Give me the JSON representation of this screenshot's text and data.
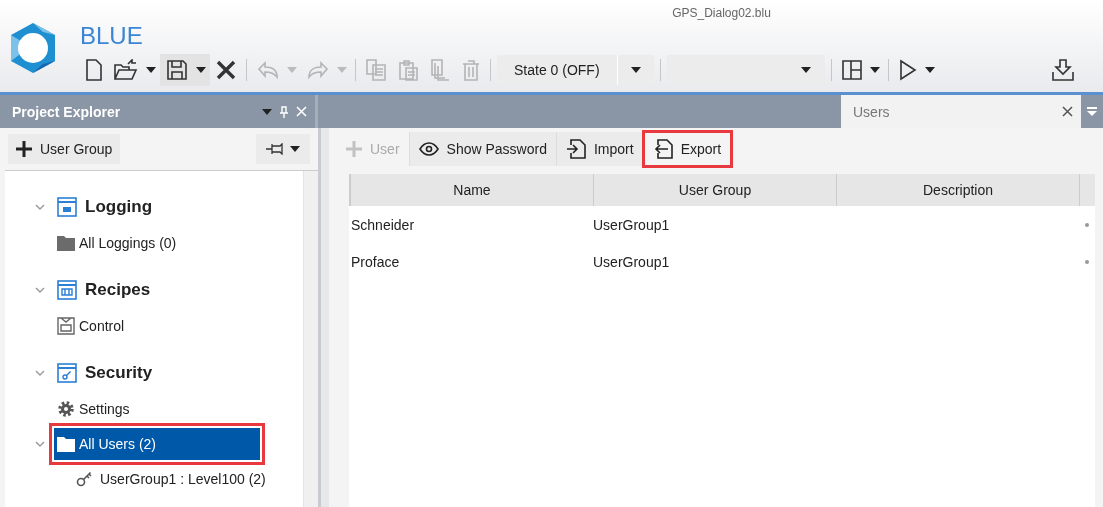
{
  "window": {
    "title": "GPS_Dialog02.blu"
  },
  "app": {
    "name": "BLUE"
  },
  "toolbar": [
    {
      "kind": "new",
      "disabled": false,
      "dropdown": false,
      "pressed": false
    },
    {
      "kind": "open",
      "disabled": false,
      "dropdown": true,
      "pressed": false
    },
    {
      "kind": "save",
      "disabled": false,
      "dropdown": true,
      "pressed": true
    },
    {
      "kind": "close",
      "disabled": false,
      "dropdown": false,
      "pressed": false
    },
    {
      "kind": "separator"
    },
    {
      "kind": "undo",
      "disabled": true,
      "dropdown": true,
      "pressed": false
    },
    {
      "kind": "redo",
      "disabled": true,
      "dropdown": true,
      "pressed": false
    },
    {
      "kind": "separator"
    },
    {
      "kind": "copy",
      "disabled": true,
      "dropdown": false,
      "pressed": false
    },
    {
      "kind": "paste",
      "disabled": true,
      "dropdown": false,
      "pressed": false
    },
    {
      "kind": "duplicate",
      "disabled": true,
      "dropdown": false,
      "pressed": false
    },
    {
      "kind": "delete",
      "disabled": true,
      "dropdown": false,
      "pressed": false
    },
    {
      "kind": "separator"
    },
    {
      "kind": "combo",
      "value": "State 0 (OFF)"
    },
    {
      "kind": "separator"
    },
    {
      "kind": "combo"
    },
    {
      "kind": "separator"
    },
    {
      "kind": "layout",
      "disabled": false,
      "dropdown": true,
      "pressed": false
    },
    {
      "kind": "separator"
    },
    {
      "kind": "play",
      "disabled": false,
      "dropdown": true,
      "pressed": false
    },
    {
      "kind": "spacer"
    },
    {
      "kind": "download",
      "disabled": false,
      "dropdown": false,
      "pressed": false
    }
  ],
  "explorer": {
    "title": "Project Explorer",
    "add_button": "User Group",
    "tree": [
      {
        "label": "Logging",
        "kind": "logging",
        "expanded": true,
        "selected": false,
        "highlighted": false,
        "children": [
          {
            "label": "All Loggings (0)",
            "kind": "folder",
            "selected": false,
            "highlighted": false
          }
        ]
      },
      {
        "label": "Recipes",
        "kind": "recipes",
        "expanded": true,
        "selected": false,
        "highlighted": false,
        "children": [
          {
            "label": "Control",
            "kind": "control",
            "selected": false,
            "highlighted": false
          }
        ]
      },
      {
        "label": "Security",
        "kind": "security",
        "expanded": true,
        "selected": false,
        "highlighted": false,
        "children": [
          {
            "label": "Settings",
            "kind": "settings",
            "selected": false,
            "highlighted": false
          },
          {
            "label": "All Users (2)",
            "kind": "folder",
            "expanded": true,
            "selected": true,
            "highlighted": true,
            "children": [
              {
                "label": "UserGroup1 : Level100 (2)",
                "kind": "key",
                "selected": false,
                "highlighted": false
              }
            ]
          }
        ]
      }
    ]
  },
  "tabs": [
    {
      "label": "Users",
      "selected": true
    }
  ],
  "users_toolbar": [
    {
      "kind": "add",
      "label": "User",
      "disabled": true,
      "highlighted": false
    },
    {
      "kind": "eye",
      "label": "Show Password",
      "disabled": false,
      "highlighted": false
    },
    {
      "kind": "import",
      "label": "Import",
      "disabled": false,
      "highlighted": false
    },
    {
      "kind": "export",
      "label": "Export",
      "disabled": false,
      "highlighted": true
    }
  ],
  "table": {
    "columns": [
      "Name",
      "User Group",
      "Description"
    ],
    "rows": [
      {
        "name": "Schneider",
        "user_group": "UserGroup1"
      },
      {
        "name": "Proface",
        "user_group": "UserGroup1"
      }
    ]
  }
}
